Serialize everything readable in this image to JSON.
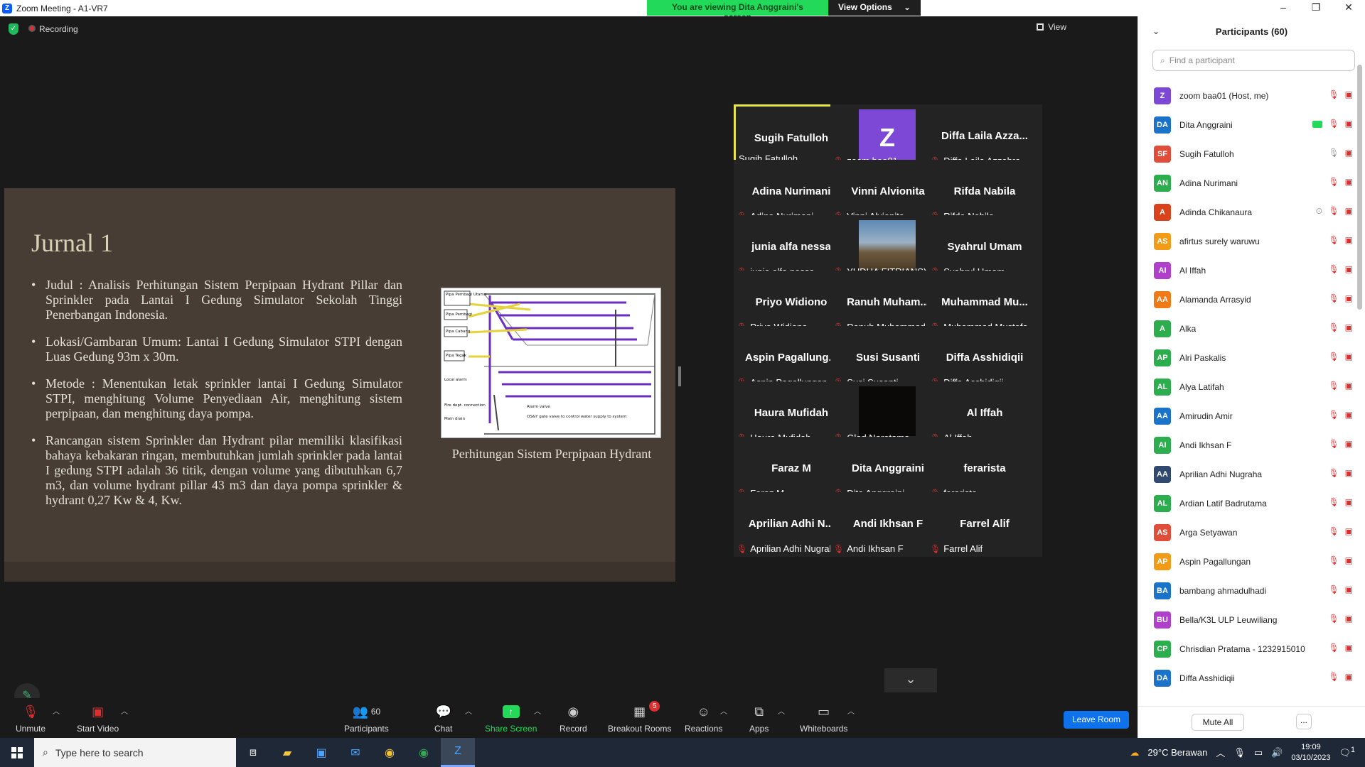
{
  "window": {
    "title": "Zoom Meeting - A1-VR7",
    "viewing_banner": "You are viewing Dita Anggraini's screen",
    "view_options": "View Options"
  },
  "meeting": {
    "recording_label": "Recording",
    "view_label": "View"
  },
  "slide": {
    "title": "Jurnal 1",
    "bullets": [
      "Judul : Analisis Perhitungan Sistem Perpipaan Hydrant Pillar dan Sprinkler pada Lantai I Gedung Simulator Sekolah Tinggi Penerbangan Indonesia.",
      "Lokasi/Gambaran Umum: Lantai I Gedung Simulator STPI dengan Luas Gedung 93m x 30m.",
      "Metode : Menentukan letak sprinkler lantai I Gedung Simulator STPI, menghitung Volume Penyediaan Air, menghitung sistem perpipaan, dan menghitung daya pompa.",
      "Rancangan sistem Sprinkler dan Hydrant pilar memiliki klasifikasi bahaya kebakaran ringan, membutuhkan jumlah sprinkler pada lantai I gedung STPI adalah 36 titik, dengan volume yang dibutuhkan 6,7 m3, dan volume hydrant pillar 43 m3  dan daya pompa sprinkler & hydrant 0,27 Kw & 4, Kw."
    ],
    "figure_labels": [
      "Pipa Pembagi Utama",
      "Pipa Pembagi",
      "Pipa Cabang",
      "Pipa Tegak",
      "Local alarm",
      "Fire dept. connection",
      "Main drain",
      "Alarm valve",
      "OS&Y gate valve to control water supply to system"
    ],
    "caption": "Perhitungan Sistem Perpipaan Hydrant"
  },
  "gallery": {
    "tiles": [
      {
        "big": "Sugih Fatulloh",
        "label": "Sugih Fatulloh",
        "muted": false,
        "kind": "name",
        "active": true
      },
      {
        "big": "Z",
        "label": "zoom baa01",
        "muted": true,
        "kind": "avatar"
      },
      {
        "big": "Diffa Laila Azza...",
        "label": "Diffa Laila Azzahra",
        "muted": true,
        "kind": "name"
      },
      {
        "big": "Adina Nurimani",
        "label": "Adina Nurimani",
        "muted": true,
        "kind": "name"
      },
      {
        "big": "Vinni Alvionita",
        "label": "Vinni Alvionita",
        "muted": true,
        "kind": "name"
      },
      {
        "big": "Rifda Nabila",
        "label": "Rifda Nabila",
        "muted": true,
        "kind": "name"
      },
      {
        "big": "junia alfa nessa",
        "label": "junia alfa nessa",
        "muted": true,
        "kind": "name"
      },
      {
        "big": "",
        "label": "YUDHA FITRIANSYAH_...",
        "muted": true,
        "kind": "photo"
      },
      {
        "big": "Syahrul Umam",
        "label": "Syahrul Umam",
        "muted": true,
        "kind": "name"
      },
      {
        "big": "Priyo Widiono",
        "label": "Priyo Widiono",
        "muted": true,
        "kind": "name"
      },
      {
        "big": "Ranuh  Muham...",
        "label": "Ranuh Muhammad",
        "muted": true,
        "kind": "name"
      },
      {
        "big": "Muhammad  Mu...",
        "label": "Muhammad Mustofa",
        "muted": true,
        "kind": "name"
      },
      {
        "big": "Aspin  Pagallung...",
        "label": "Aspin Pagallungan",
        "muted": true,
        "kind": "name"
      },
      {
        "big": "Susi Susanti",
        "label": "Susi Susanti",
        "muted": true,
        "kind": "name"
      },
      {
        "big": "Diffa Asshidiqii",
        "label": "Diffa Asshidiqii",
        "muted": true,
        "kind": "name"
      },
      {
        "big": "Haura Mufidah",
        "label": "Haura Mufidah",
        "muted": true,
        "kind": "name"
      },
      {
        "big": "",
        "label": "Glad Narotama",
        "muted": true,
        "kind": "black"
      },
      {
        "big": "Al Iffah",
        "label": "Al Iffah",
        "muted": true,
        "kind": "name"
      },
      {
        "big": "Faraz M",
        "label": "Faraz M",
        "muted": true,
        "kind": "name"
      },
      {
        "big": "Dita Anggraini",
        "label": "Dita Anggraini",
        "muted": true,
        "kind": "name"
      },
      {
        "big": "ferarista",
        "label": "ferarista",
        "muted": true,
        "kind": "name"
      },
      {
        "big": "Aprilian  Adhi  N...",
        "label": "Aprilian Adhi Nugraha",
        "muted": true,
        "kind": "name"
      },
      {
        "big": "Andi Ikhsan F",
        "label": "Andi Ikhsan F",
        "muted": true,
        "kind": "name"
      },
      {
        "big": "Farrel Alif",
        "label": "Farrel Alif",
        "muted": true,
        "kind": "name"
      }
    ]
  },
  "toolbar": {
    "unmute": "Unmute",
    "start_video": "Start Video",
    "participants": "Participants",
    "participants_count": "60",
    "chat": "Chat",
    "share_screen": "Share Screen",
    "record": "Record",
    "breakout_rooms": "Breakout Rooms",
    "breakout_badge": "5",
    "reactions": "Reactions",
    "apps": "Apps",
    "whiteboards": "Whiteboards",
    "leave": "Leave Room"
  },
  "panel": {
    "title": "Participants (60)",
    "search_placeholder": "Find a participant",
    "mute_all": "Mute All",
    "more": "...",
    "participants": [
      {
        "initials": "Z",
        "name": "zoom baa01 (Host, me)",
        "color": "#7d48d6",
        "extra": ""
      },
      {
        "initials": "DA",
        "name": "Dita Anggraini",
        "color": "#1a73c8",
        "extra": "sharing"
      },
      {
        "initials": "SF",
        "name": "Sugih Fatulloh",
        "color": "#e04e3a",
        "extra": "unmuted"
      },
      {
        "initials": "AN",
        "name": "Adina Nurimani",
        "color": "#2dae4e",
        "extra": ""
      },
      {
        "initials": "A",
        "name": "Adinda Chikanaura",
        "color": "#d9421a",
        "extra": "record"
      },
      {
        "initials": "AS",
        "name": "afirtus surely waruwu",
        "color": "#f29b16",
        "extra": ""
      },
      {
        "initials": "AI",
        "name": "Al Iffah",
        "color": "#b03fcc",
        "extra": ""
      },
      {
        "initials": "AA",
        "name": "Alamanda Arrasyid",
        "color": "#f07a16",
        "extra": ""
      },
      {
        "initials": "A",
        "name": "Alka",
        "color": "#2dae4e",
        "extra": ""
      },
      {
        "initials": "AP",
        "name": "Alri Paskalis",
        "color": "#2dae4e",
        "extra": ""
      },
      {
        "initials": "AL",
        "name": "Alya Latifah",
        "color": "#2dae4e",
        "extra": ""
      },
      {
        "initials": "AA",
        "name": "Amirudin Amir",
        "color": "#1a73c8",
        "extra": ""
      },
      {
        "initials": "AI",
        "name": "Andi Ikhsan F",
        "color": "#2dae4e",
        "extra": ""
      },
      {
        "initials": "AA",
        "name": "Aprilian Adhi Nugraha",
        "color": "#2f4a6e",
        "extra": ""
      },
      {
        "initials": "AL",
        "name": "Ardian Latif Badrutama",
        "color": "#2dae4e",
        "extra": ""
      },
      {
        "initials": "AS",
        "name": "Arga Setyawan",
        "color": "#e04e3a",
        "extra": ""
      },
      {
        "initials": "AP",
        "name": "Aspin Pagallungan",
        "color": "#f29b16",
        "extra": ""
      },
      {
        "initials": "BA",
        "name": "bambang ahmadulhadi",
        "color": "#1a73c8",
        "extra": ""
      },
      {
        "initials": "BU",
        "name": "Bella/K3L ULP Leuwiliang",
        "color": "#b03fcc",
        "extra": ""
      },
      {
        "initials": "CP",
        "name": "Chrisdian Pratama - 1232915010",
        "color": "#2dae4e",
        "extra": ""
      },
      {
        "initials": "DA",
        "name": "Diffa Asshidiqii",
        "color": "#1a73c8",
        "extra": ""
      }
    ]
  },
  "taskbar": {
    "search_placeholder": "Type here to search",
    "weather": "29°C  Berawan",
    "time": "19:09",
    "date": "03/10/2023",
    "notif": "1"
  }
}
